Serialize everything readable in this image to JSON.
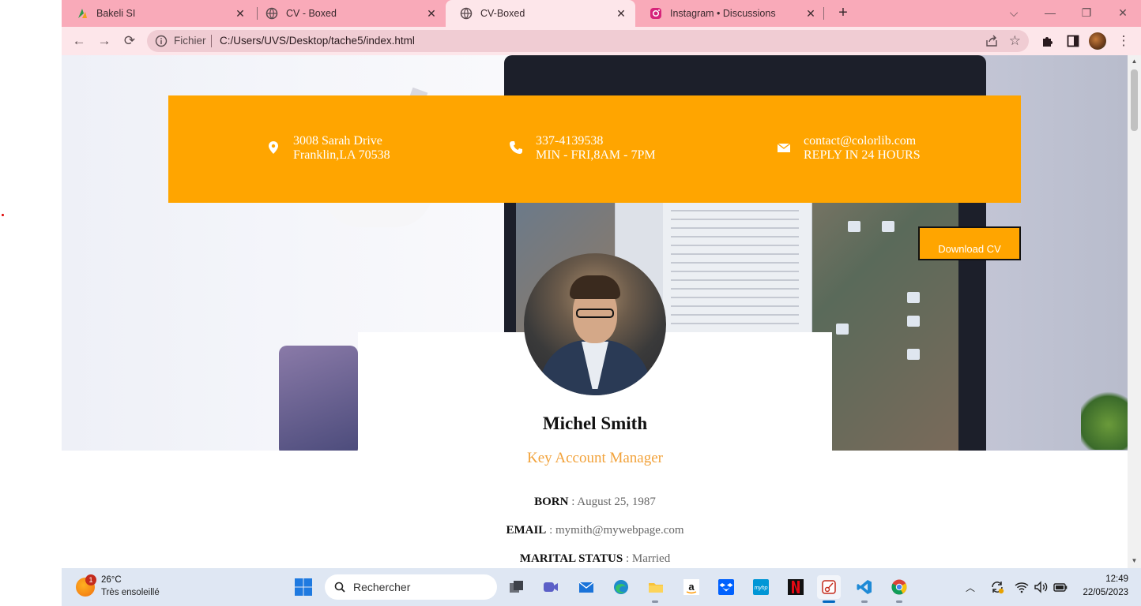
{
  "browser": {
    "tabs": [
      {
        "label": "Bakeli SI",
        "favicon": "bakeli-icon",
        "active": false
      },
      {
        "label": "CV - Boxed",
        "favicon": "globe-icon",
        "active": false
      },
      {
        "label": "CV-Boxed",
        "favicon": "globe-icon",
        "active": true
      },
      {
        "label": "Instagram • Discussions",
        "favicon": "instagram-icon",
        "active": false
      }
    ],
    "address": {
      "scheme_label": "Fichier",
      "url": "C:/Users/UVS/Desktop/tache5/index.html"
    }
  },
  "contact": {
    "address_line1": "3008 Sarah Drive",
    "address_line2": "Franklin,LA 70538",
    "phone_line1": "337-4139538",
    "phone_line2": "MIN - FRI,8AM - 7PM",
    "email_line1": "contact@colorlib.com",
    "email_line2": "REPLY IN 24 HOURS",
    "accent_color": "#ffa500"
  },
  "download_button": "Download CV",
  "profile": {
    "name": "Michel Smith",
    "role": "Key Account Manager",
    "born_label": "BORN",
    "born_value": "August 25, 1987",
    "email_label": "EMAIL",
    "email_value": "mymith@mywebpage.com",
    "marital_label": "MARITAL STATUS",
    "marital_value": "Married",
    "separator": " : "
  },
  "taskbar": {
    "weather_temp": "26°C",
    "weather_desc": "Très ensoleillé",
    "weather_badge": "1",
    "search_placeholder": "Rechercher",
    "time": "12:49",
    "date": "22/05/2023",
    "apps": [
      "task-view",
      "teams-meet",
      "mail",
      "edge",
      "file-explorer",
      "amazon",
      "dropbox",
      "myhp",
      "netflix",
      "snipping-tool",
      "vscode",
      "chrome"
    ]
  }
}
